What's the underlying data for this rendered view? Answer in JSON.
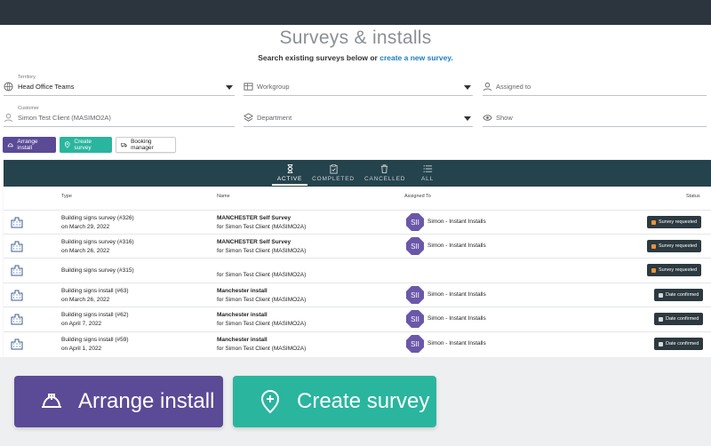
{
  "header": {
    "title": "Surveys & installs",
    "subtitle_prefix": "Search existing surveys below or",
    "subtitle_link": "create a new survey."
  },
  "filters": {
    "territory": {
      "label": "Territory",
      "value": "Head Office Teams"
    },
    "workgroup": {
      "placeholder": "Workgroup"
    },
    "assigned_to": {
      "placeholder": "Assigned to"
    },
    "customer": {
      "label": "Customer",
      "value": "Simon Test Client (MASIMO2A)"
    },
    "department": {
      "placeholder": "Department"
    },
    "show": {
      "placeholder": "Show"
    }
  },
  "actions": {
    "arrange_install": "Arrange install",
    "create_survey": "Create survey",
    "booking_manager": "Booking manager"
  },
  "tabs": [
    {
      "label": "ACTIVE",
      "icon": "hourglass-icon"
    },
    {
      "label": "COMPLETED",
      "icon": "clipboard-check-icon"
    },
    {
      "label": "CANCELLED",
      "icon": "trash-icon"
    },
    {
      "label": "ALL",
      "icon": "list-icon"
    }
  ],
  "table": {
    "columns": {
      "type": "Type",
      "name": "Name",
      "assigned_to": "Assigned To",
      "status": "Status"
    },
    "rows": [
      {
        "type": "Building signs survey (#326)",
        "date": "on March 29, 2022",
        "name": "MANCHESTER Self Survey",
        "customer": "for Simon Test Client (MASIMO2A)",
        "avatar": "SII",
        "assignee": "Simon - Instant Installs",
        "status": "Survey requested"
      },
      {
        "type": "Building signs survey (#316)",
        "date": "on March 26, 2022",
        "name": "MANCHESTER Self Survey",
        "customer": "for Simon Test Client (MASIMO2A)",
        "avatar": "SII",
        "assignee": "Simon - Instant Installs",
        "status": "Survey requested"
      },
      {
        "type": "Building signs survey (#315)",
        "date": "",
        "name": "",
        "customer": "for Simon Test Client (MASIMO2A)",
        "avatar": "",
        "assignee": "",
        "status": "Survey requested"
      },
      {
        "type": "Building signs install (#63)",
        "date": "on March 26, 2022",
        "name": "Manchester install",
        "customer": "for Simon Test Client (MASIMO2A)",
        "avatar": "SII",
        "assignee": "Simon - Instant Installs",
        "status": "Date confirmed"
      },
      {
        "type": "Building signs install (#62)",
        "date": "on April 7, 2022",
        "name": "Manchester install",
        "customer": "for Simon Test Client (MASIMO2A)",
        "avatar": "SII",
        "assignee": "Simon - Instant Installs",
        "status": "Date confirmed"
      },
      {
        "type": "Building signs install (#59)",
        "date": "on April 1, 2022",
        "name": "Manchester install",
        "customer": "for Simon Test Client (MASIMO2A)",
        "avatar": "SII",
        "assignee": "Simon - Instant Installs",
        "status": "Date confirmed"
      }
    ]
  },
  "bottom": {
    "arrange_install": "Arrange install",
    "create_survey": "Create survey"
  },
  "colors": {
    "purple": "#5b4a96",
    "teal": "#2ab59f",
    "dark_teal": "#25434c",
    "link": "#1a7fc0"
  }
}
